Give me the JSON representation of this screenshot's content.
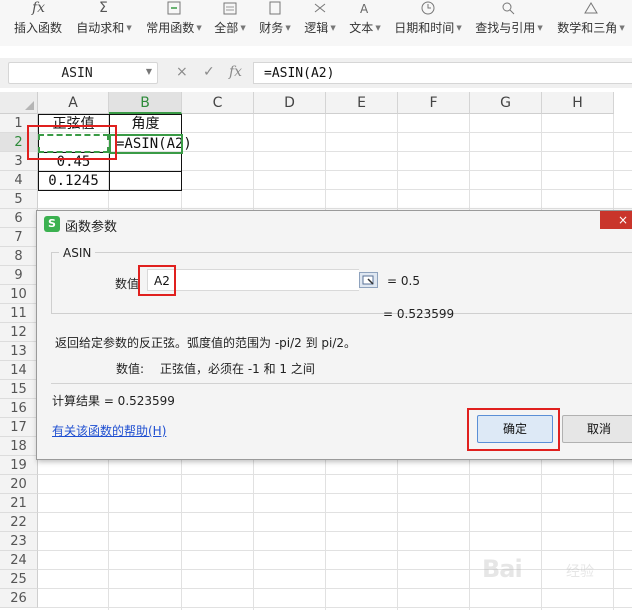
{
  "ribbon": {
    "items": [
      {
        "label": "插入函数",
        "icon": "insert-function-icon",
        "dropdown": false
      },
      {
        "label": "自动求和",
        "icon": "autosum-icon",
        "dropdown": true
      },
      {
        "label": "常用函数",
        "icon": "common-functions-icon",
        "dropdown": true
      },
      {
        "label": "全部",
        "icon": "all-functions-icon",
        "dropdown": true
      },
      {
        "label": "财务",
        "icon": "finance-icon",
        "dropdown": true
      },
      {
        "label": "逻辑",
        "icon": "logic-icon",
        "dropdown": true
      },
      {
        "label": "文本",
        "icon": "text-icon",
        "dropdown": true
      },
      {
        "label": "日期和时间",
        "icon": "datetime-icon",
        "dropdown": true
      },
      {
        "label": "查找与引用",
        "icon": "lookup-icon",
        "dropdown": true
      },
      {
        "label": "数学和三角",
        "icon": "math-icon",
        "dropdown": true
      }
    ]
  },
  "formula_bar": {
    "name_box": "ASIN",
    "cancel_glyph": "×",
    "confirm_glyph": "✓",
    "fx_glyph": "fx",
    "formula": "=ASIN(A2)"
  },
  "sheet": {
    "columns": [
      "A",
      "B",
      "C",
      "D",
      "E",
      "F",
      "G",
      "H"
    ],
    "rows": [
      "1",
      "2",
      "3",
      "4",
      "5",
      "6",
      "7",
      "8",
      "9",
      "10",
      "11",
      "12",
      "13",
      "14",
      "15",
      "16",
      "17",
      "18",
      "19",
      "20",
      "21",
      "22",
      "23",
      "24",
      "25",
      "26"
    ],
    "selected_column": "B",
    "selected_row": "2",
    "cells": {
      "A1": "正弦值",
      "B1": "角度",
      "B2": "=ASIN(A2)",
      "A3": "0.45",
      "A4": "0.1245"
    },
    "colors": {
      "selection": "#3a9b46",
      "highlight": "#e0201e"
    }
  },
  "dialog": {
    "title": "函数参数",
    "logo_glyph": "S",
    "close_glyph": "×",
    "function_name": "ASIN",
    "arg_label": "数值",
    "arg_value": "A2",
    "arg_result": "= 0.5",
    "formula_result": "= 0.523599",
    "description": "返回给定参数的反正弦。弧度值的范围为 -pi/2 到 pi/2。",
    "param_name": "数值:",
    "param_desc": "正弦值，必须在 -1 和 1 之间",
    "calc_result": "计算结果 =  0.523599",
    "help_link": "有关该函数的帮助(H)",
    "ok_label": "确定",
    "cancel_label": "取消"
  },
  "watermark": {
    "text": "Bai",
    "sub": "经验"
  }
}
